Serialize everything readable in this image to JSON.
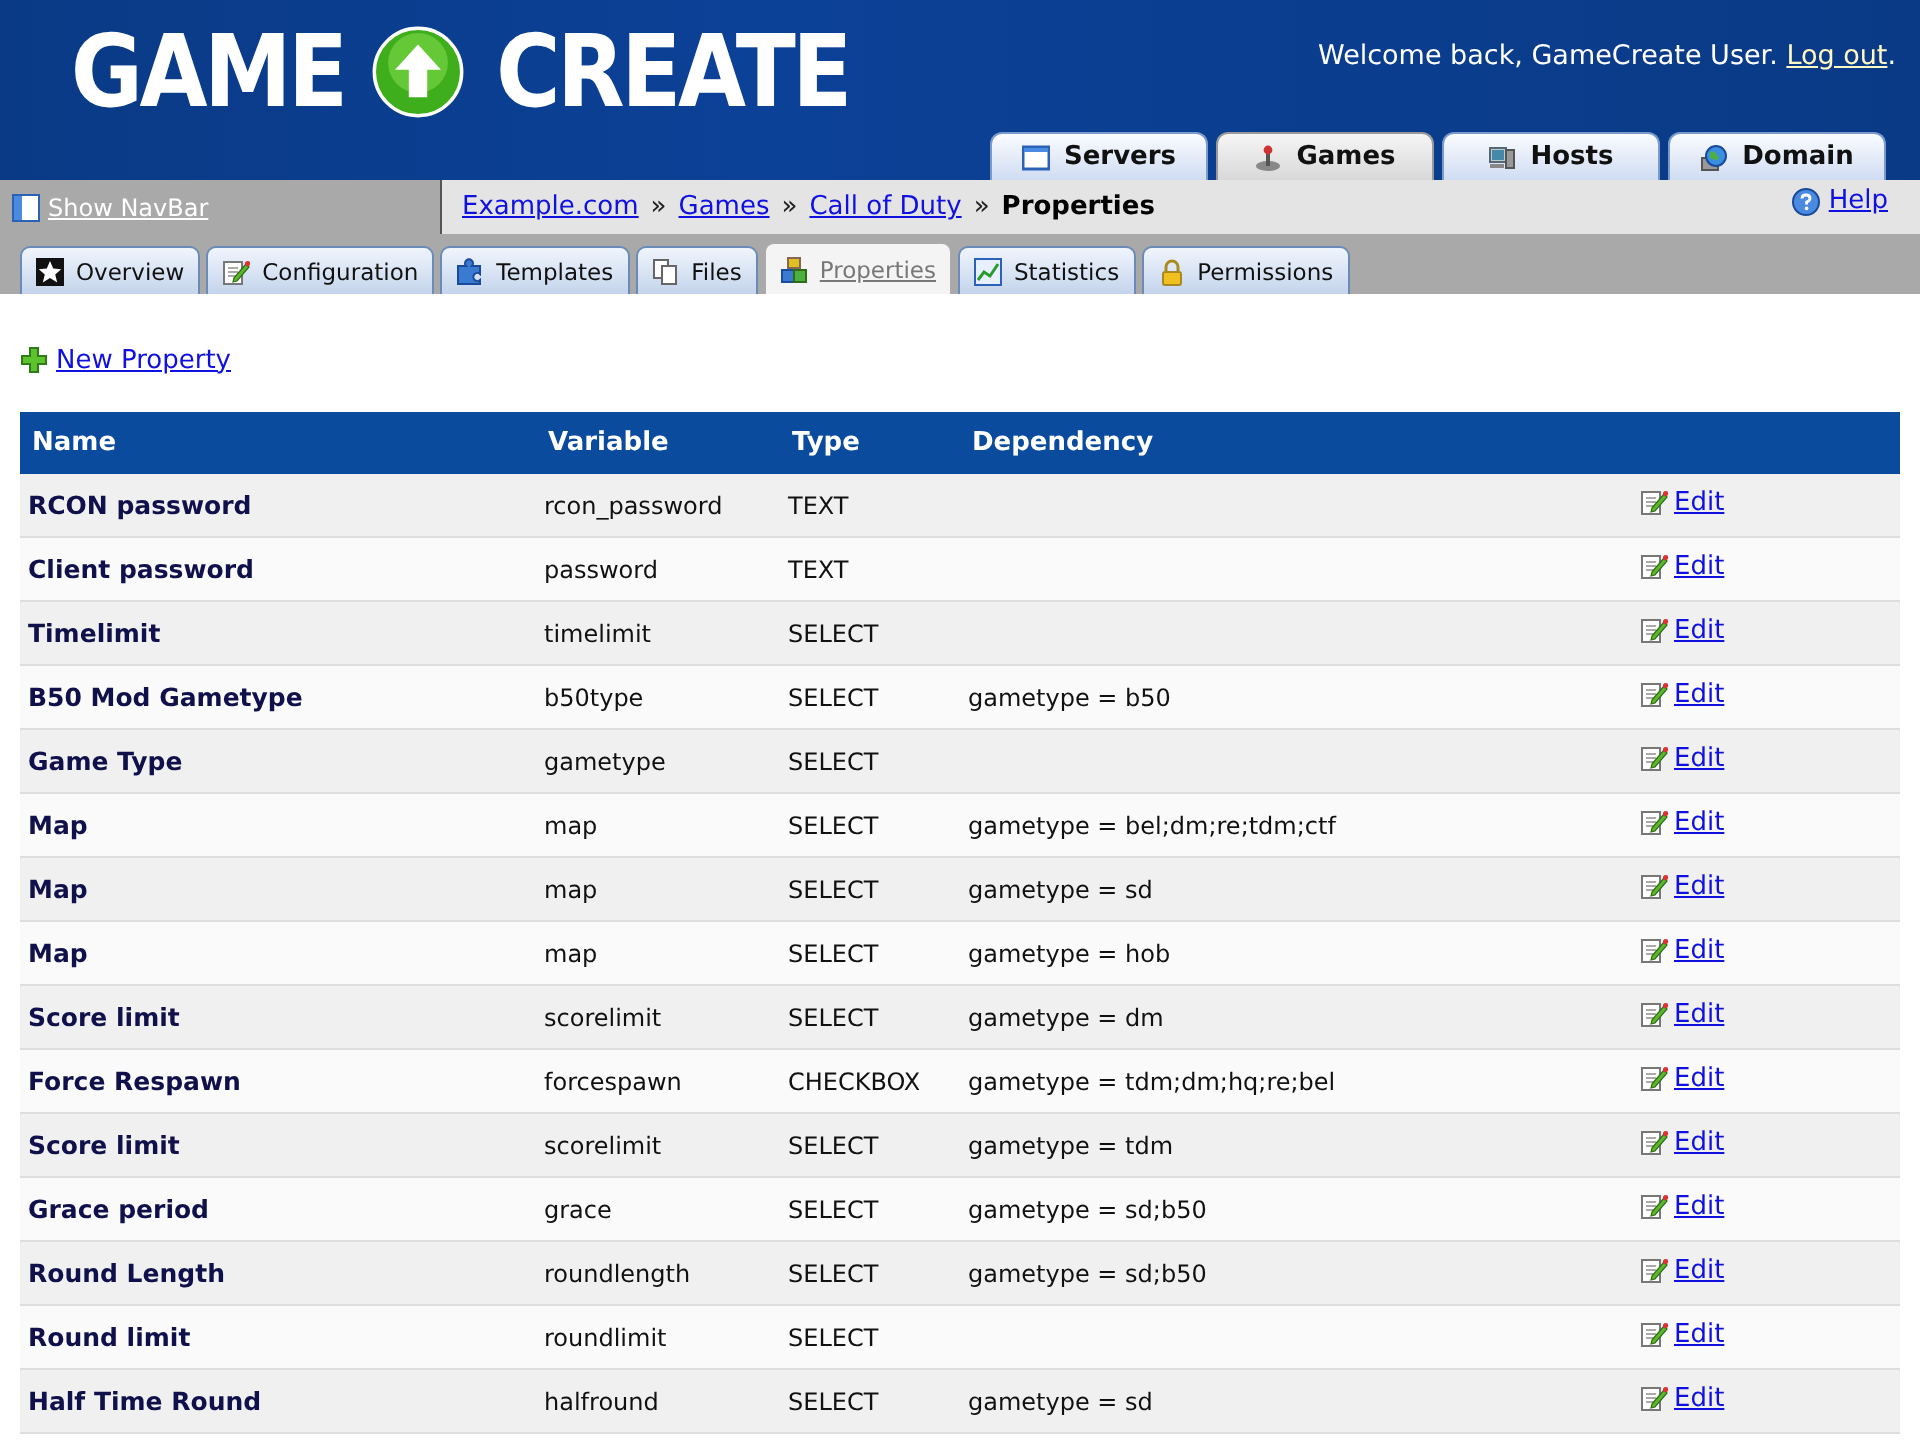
{
  "logo": {
    "left": "GAME",
    "right": "CREATE"
  },
  "welcome": {
    "text": "Welcome back, GameCreate User.",
    "logout": "Log out",
    "after": "."
  },
  "top_tabs": [
    {
      "label": "Servers",
      "selected": false
    },
    {
      "label": "Games",
      "selected": true
    },
    {
      "label": "Hosts",
      "selected": false
    },
    {
      "label": "Domain",
      "selected": false
    }
  ],
  "navbar_toggle": "Show NavBar",
  "breadcrumb": [
    {
      "label": "Example.com",
      "kind": "link"
    },
    {
      "separator": "»",
      "label": "Games",
      "kind": "link"
    },
    {
      "separator": "»",
      "label": "Call of Duty",
      "kind": "link"
    },
    {
      "separator": "»",
      "label": "Properties",
      "kind": "current"
    }
  ],
  "help": "Help",
  "sub_tabs": [
    {
      "label": "Overview",
      "selected": false
    },
    {
      "label": "Configuration",
      "selected": false
    },
    {
      "label": "Templates",
      "selected": false
    },
    {
      "label": "Files",
      "selected": false
    },
    {
      "label": "Properties",
      "selected": true
    },
    {
      "label": "Statistics",
      "selected": false
    },
    {
      "label": "Permissions",
      "selected": false
    }
  ],
  "new_property": "New Property",
  "table": {
    "columns": [
      "Name",
      "Variable",
      "Type",
      "Dependency"
    ],
    "rows": [
      {
        "name": "RCON password",
        "variable": "rcon_password",
        "type": "TEXT",
        "action": "Edit"
      },
      {
        "name": "Client password",
        "variable": "password",
        "type": "TEXT",
        "action": "Edit"
      },
      {
        "name": "Timelimit",
        "variable": "timelimit",
        "type": "SELECT",
        "action": "Edit"
      },
      {
        "name": "B50 Mod Gametype",
        "variable": "b50type",
        "type": "SELECT",
        "dependency": "gametype = b50",
        "action": "Edit"
      },
      {
        "name": "Game Type",
        "variable": "gametype",
        "type": "SELECT",
        "action": "Edit"
      },
      {
        "name": "Map",
        "variable": "map",
        "type": "SELECT",
        "dependency": "gametype = bel;dm;re;tdm;ctf",
        "action": "Edit"
      },
      {
        "name": "Map",
        "variable": "map",
        "type": "SELECT",
        "dependency": "gametype = sd",
        "action": "Edit"
      },
      {
        "name": "Map",
        "variable": "map",
        "type": "SELECT",
        "dependency": "gametype = hob",
        "action": "Edit"
      },
      {
        "name": "Score limit",
        "variable": "scorelimit",
        "type": "SELECT",
        "dependency": "gametype = dm",
        "action": "Edit"
      },
      {
        "name": "Force Respawn",
        "variable": "forcespawn",
        "type": "CHECKBOX",
        "dependency": "gametype = tdm;dm;hq;re;bel",
        "action": "Edit"
      },
      {
        "name": "Score limit",
        "variable": "scorelimit",
        "type": "SELECT",
        "dependency": "gametype = tdm",
        "action": "Edit"
      },
      {
        "name": "Grace period",
        "variable": "grace",
        "type": "SELECT",
        "dependency": "gametype = sd;b50",
        "action": "Edit"
      },
      {
        "name": "Round Length",
        "variable": "roundlength",
        "type": "SELECT",
        "dependency": "gametype = sd;b50",
        "action": "Edit"
      },
      {
        "name": "Round limit",
        "variable": "roundlimit",
        "type": "SELECT",
        "action": "Edit"
      },
      {
        "name": "Half Time Round",
        "variable": "halfround",
        "type": "SELECT",
        "dependency": "gametype = sd",
        "action": "Edit"
      }
    ]
  }
}
